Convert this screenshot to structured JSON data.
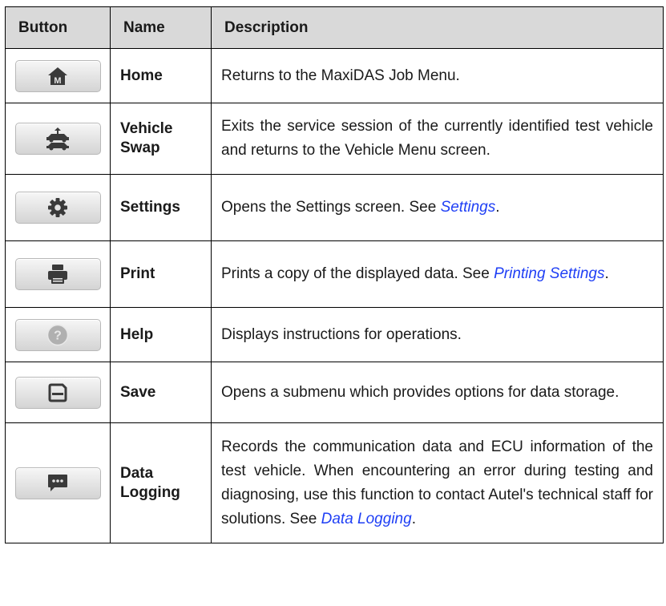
{
  "table": {
    "headers": {
      "button": "Button",
      "name": "Name",
      "description": "Description"
    },
    "rows": [
      {
        "name": "Home",
        "icon": "home-m-icon",
        "description": "Returns to the MaxiDAS Job Menu."
      },
      {
        "name_line1": "Vehicle",
        "name_line2": "Swap",
        "icon": "vehicle-swap-icon",
        "description": "Exits the service session of the currently identified test vehicle and returns to the Vehicle Menu screen."
      },
      {
        "name": "Settings",
        "icon": "gear-icon",
        "description_before": "Opens the Settings screen. See ",
        "description_link": "Settings",
        "description_after": "."
      },
      {
        "name": "Print",
        "icon": "printer-icon",
        "description_before": "Prints a copy of the displayed data. See ",
        "description_link": "Printing Settings",
        "description_after": "."
      },
      {
        "name": "Help",
        "icon": "help-question-icon",
        "description": "Displays instructions for operations."
      },
      {
        "name": "Save",
        "icon": "save-icon",
        "description": "Opens a submenu which provides options for data storage."
      },
      {
        "name_line1": "Data",
        "name_line2": "Logging",
        "icon": "chat-message-icon",
        "description_before": "Records the communication data and ECU information of the test vehicle. When encountering an error during testing and diagnosing, use this function to contact Autel's technical staff for solutions. See ",
        "description_link": "Data Logging",
        "description_after": "."
      }
    ]
  },
  "colors": {
    "header_bg": "#d9d9d9",
    "link": "#1f3ff5",
    "icon": "#3a3a3a",
    "help_icon": "#b0b0b0"
  }
}
